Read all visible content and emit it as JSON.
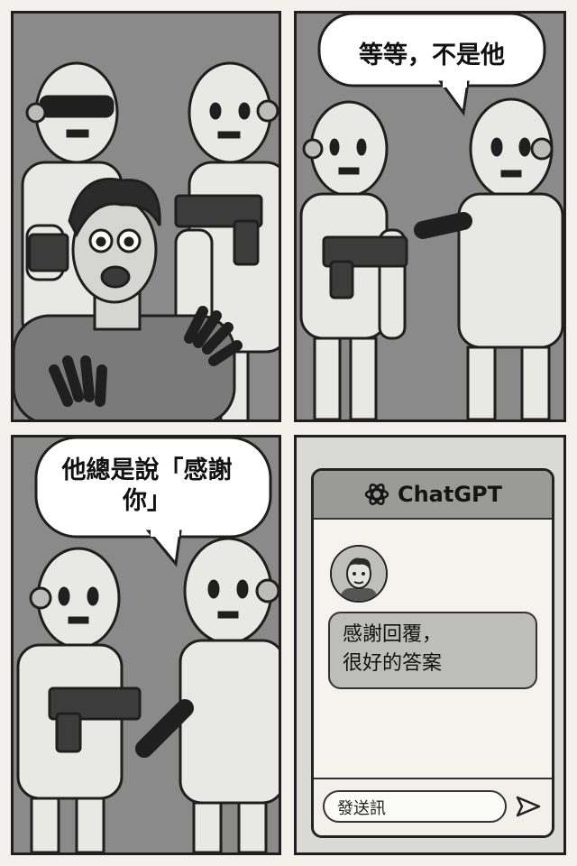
{
  "panel1": {},
  "panel2": {
    "speech": "等等，不是他"
  },
  "panel3": {
    "speech_line1": "他總是說「感謝",
    "speech_line2": "你」"
  },
  "panel4": {
    "chat": {
      "brand": "ChatGPT",
      "message_line1": "感謝回覆，",
      "message_line2": "很好的答案",
      "input_placeholder": "發送訊"
    }
  },
  "icons": {
    "logo": "openai-logo-icon",
    "send": "send-arrow-icon"
  },
  "colors": {
    "ink": "#1f1f1f",
    "panel_bg": "#8d8d8d",
    "robot": "#e8e8e4",
    "chat_header": "#9a9a97"
  }
}
